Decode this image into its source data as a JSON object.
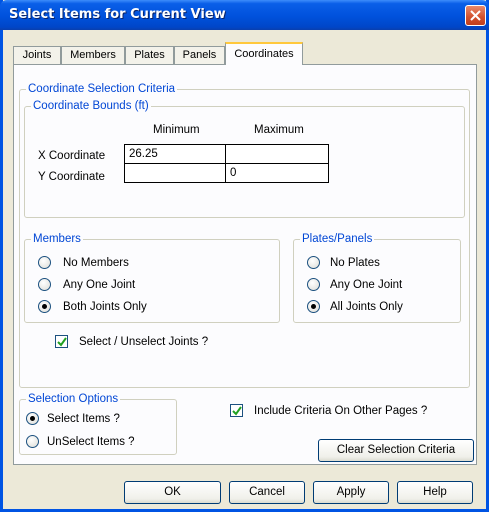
{
  "window": {
    "title": "Select Items for Current View"
  },
  "tabs": [
    {
      "label": "Joints"
    },
    {
      "label": "Members"
    },
    {
      "label": "Plates"
    },
    {
      "label": "Panels"
    },
    {
      "label": "Coordinates",
      "active": true
    }
  ],
  "criteria": {
    "title": "Coordinate Selection Criteria",
    "bounds": {
      "title": "Coordinate Bounds  (ft)",
      "min_header": "Minimum",
      "max_header": "Maximum",
      "x_label": "X Coordinate",
      "x_min": "26.25",
      "x_max": "",
      "y_label": "Y Coordinate",
      "y_min": "",
      "y_max": "0"
    },
    "members": {
      "title": "Members",
      "options": [
        {
          "label": "No Members",
          "checked": false
        },
        {
          "label": "Any One Joint",
          "checked": false
        },
        {
          "label": "Both Joints Only",
          "checked": true
        }
      ]
    },
    "plates": {
      "title": "Plates/Panels",
      "options": [
        {
          "label": "No Plates",
          "checked": false
        },
        {
          "label": "Any One Joint",
          "checked": false
        },
        {
          "label": "All Joints Only",
          "checked": true
        }
      ]
    },
    "select_joints": {
      "label": "Select / Unselect Joints ?",
      "checked": true
    }
  },
  "selection_options": {
    "title": "Selection Options",
    "options": [
      {
        "label": "Select Items ?",
        "checked": true
      },
      {
        "label": "UnSelect Items ?",
        "checked": false
      }
    ]
  },
  "include_criteria": {
    "label": "Include Criteria On Other Pages ?",
    "checked": true
  },
  "clear_button": "Clear Selection Criteria",
  "buttons": {
    "ok": "OK",
    "cancel": "Cancel",
    "apply": "Apply",
    "help": "Help"
  }
}
